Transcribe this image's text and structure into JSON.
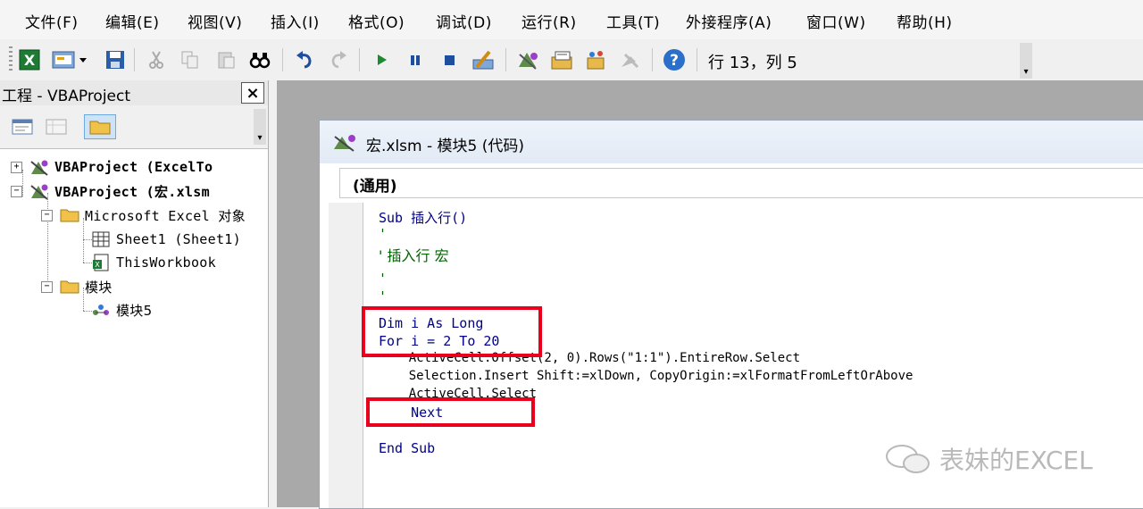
{
  "menubar": {
    "items": [
      "文件(F)",
      "编辑(E)",
      "视图(V)",
      "插入(I)",
      "格式(O)",
      "调试(D)",
      "运行(R)",
      "工具(T)",
      "外接程序(A)",
      "窗口(W)",
      "帮助(H)"
    ]
  },
  "toolbar": {
    "position_readout": "行 13，列 5"
  },
  "project": {
    "title": "工程 - VBAProject",
    "close_label": "×",
    "tree": [
      "VBAProject (ExcelTo",
      "VBAProject (宏.xlsm",
      "Microsoft Excel 对象",
      "Sheet1 (Sheet1)",
      "ThisWorkbook",
      "模块",
      "模块5"
    ]
  },
  "code_window": {
    "title": "宏.xlsm - 模块5 (代码)",
    "object": "(通用)",
    "lines": [
      "Sub 插入行()",
      "'",
      "' 插入行 宏",
      "'",
      "'",
      "Dim i As Long",
      "For i = 2 To 20",
      "    ActiveCell.Offset(2, 0).Rows(\"1:1\").EntireRow.Select",
      "    Selection.Insert Shift:=xlDown, CopyOrigin:=xlFormatFromLeftOrAbove",
      "    ActiveCell.Select",
      "    Next",
      "End Sub"
    ]
  },
  "watermark": "表妹的EXCEL",
  "colors": {
    "highlight": "#e8001c",
    "keyword": "#00008b",
    "comment": "#006400"
  }
}
